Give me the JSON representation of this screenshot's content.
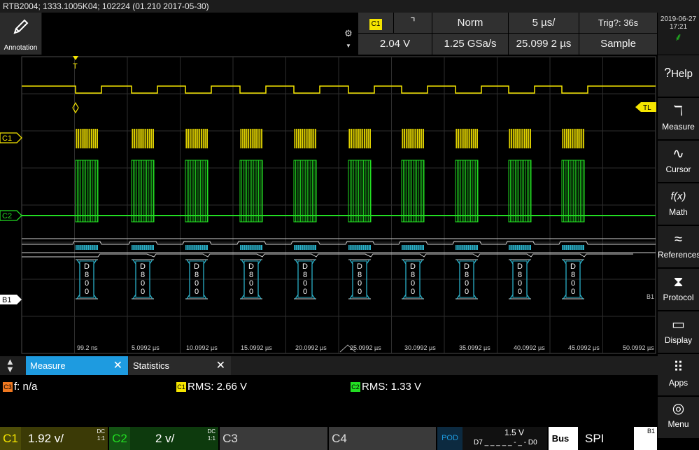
{
  "title": "RTB2004; 1333.1005K04; 102224 (01.210 2017-05-30)",
  "annotation_label": "Annotation",
  "gear_icon": "⚙",
  "trigger": {
    "source": "C1",
    "slope": "⌝",
    "mode": "Norm",
    "timebase": "5 µs/",
    "status": "Trig?: 36s",
    "level": "2.04 V",
    "sample_rate": "1.25 GSa/s",
    "position": "25.099 2 µs",
    "acquisition": "Sample"
  },
  "clock": {
    "date": "2019-06-27",
    "time": "17:21"
  },
  "sidebar": [
    {
      "name": "help",
      "icon": "?",
      "label": "Help"
    },
    {
      "name": "measure",
      "icon": "ℸ",
      "label": "Measure"
    },
    {
      "name": "cursor",
      "icon": "∿",
      "label": "Cursor"
    },
    {
      "name": "math",
      "icon": "f(x)",
      "label": "Math"
    },
    {
      "name": "references",
      "icon": "≈",
      "label": "References"
    },
    {
      "name": "protocol",
      "icon": "⧗",
      "label": "Protocol"
    },
    {
      "name": "display",
      "icon": "▭",
      "label": "Display"
    },
    {
      "name": "apps",
      "icon": "⠿",
      "label": "Apps"
    },
    {
      "name": "menu",
      "icon": "◎",
      "label": "Menu"
    }
  ],
  "markers": {
    "trigger": "T",
    "c1": "C1",
    "c2": "C2",
    "b1": "B1",
    "tl": "TL",
    "b1_right": "B1"
  },
  "decode_label": [
    "D",
    "8",
    "0",
    "0"
  ],
  "time_labels": [
    "99.2 ns",
    "5.0992 µs",
    "10.0992 µs",
    "15.0992 µs",
    "20.0992 µs",
    "25.0992 µs",
    "30.0992 µs",
    "35.0992 µs",
    "40.0992 µs",
    "45.0992 µs",
    "50.0992 µs"
  ],
  "tabs": {
    "measure": "Measure",
    "statistics": "Statistics",
    "close": "✕"
  },
  "measurements": [
    {
      "badge": "C3",
      "text": "f: n/a",
      "color": "#f07820"
    },
    {
      "badge": "C1",
      "text": "RMS: 2.66 V",
      "color": "#f5e500"
    },
    {
      "badge": "C2",
      "text": "RMS: 1.33 V",
      "color": "#22dd22"
    }
  ],
  "channels": {
    "c1": {
      "name": "C1",
      "value": "1.92 v/",
      "coupling": "DC",
      "ratio": "1:1"
    },
    "c2": {
      "name": "C2",
      "value": "2 v/",
      "coupling": "DC",
      "ratio": "1:1"
    },
    "c3": {
      "name": "C3"
    },
    "c4": {
      "name": "C4"
    },
    "logic": {
      "name": "POD",
      "threshold": "1.5 V",
      "range_lo": "D7",
      "range_hi": "D0",
      "pattern": "_ _ _ _ _ - _ -"
    },
    "bus": {
      "name": "Bus",
      "protocol": "SPI",
      "id": "B1"
    }
  },
  "colors": {
    "c1": "#f5e500",
    "c2": "#22dd22",
    "c3": "#f07820",
    "bus": "#2ab0c8",
    "tab_active": "#1e9be0",
    "logic": "#1e9be0"
  }
}
